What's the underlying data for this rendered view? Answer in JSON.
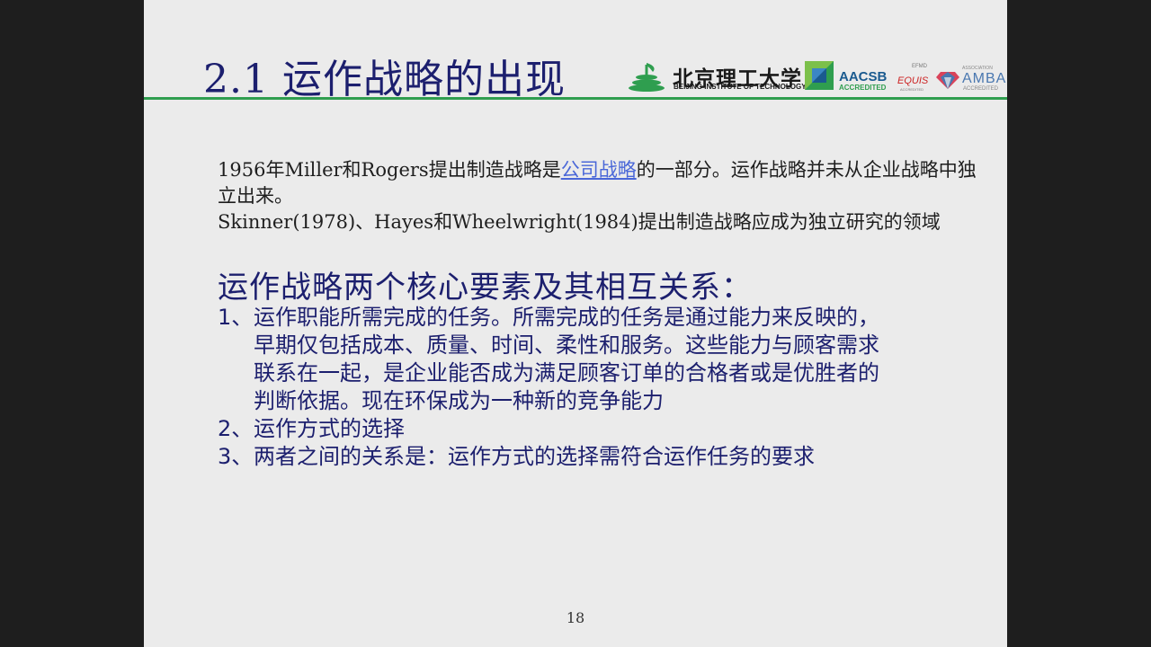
{
  "slide": {
    "title": "2.1 运作战略的出现",
    "page_number": "18"
  },
  "logos": {
    "bit_cn": "北京理工大学",
    "bit_en": "BEIJING INSTITUTE OF TECHNOLOGY",
    "aacsb": "AACSB",
    "aacsb_sub": "ACCREDITED",
    "efmd": "EFMD",
    "equis": "EQUIS",
    "equis_sub": "ACCREDITED",
    "amba_assoc": "ASSOCIATION",
    "amba": "AMBA",
    "amba_sub": "ACCREDITED"
  },
  "intro": {
    "p1_before": "1956年Miller和Rogers提出制造战略是",
    "p1_link": "公司战略",
    "p1_after": "的一部分。运作战略并未从企业战略中独立出来。",
    "p2": "Skinner(1978)、Hayes和Wheelwright(1984)提出制造战略应成为独立研究的领域"
  },
  "section": {
    "heading": "运作战略两个核心要素及其相互关系：",
    "items": [
      {
        "num": "1、",
        "lines": [
          "运作职能所需完成的任务。所需完成的任务是通过能力来反映的，",
          "早期仅包括成本、质量、时间、柔性和服务。这些能力与顾客需求",
          "联系在一起，是企业能否成为满足顾客订单的合格者或是优胜者的",
          "判断依据。现在环保成为一种新的竞争能力"
        ]
      },
      {
        "num": "2、",
        "lines": [
          "运作方式的选择"
        ]
      },
      {
        "num": "3、",
        "lines": [
          "两者之间的关系是：运作方式的选择需符合运作任务的要求"
        ]
      }
    ]
  }
}
